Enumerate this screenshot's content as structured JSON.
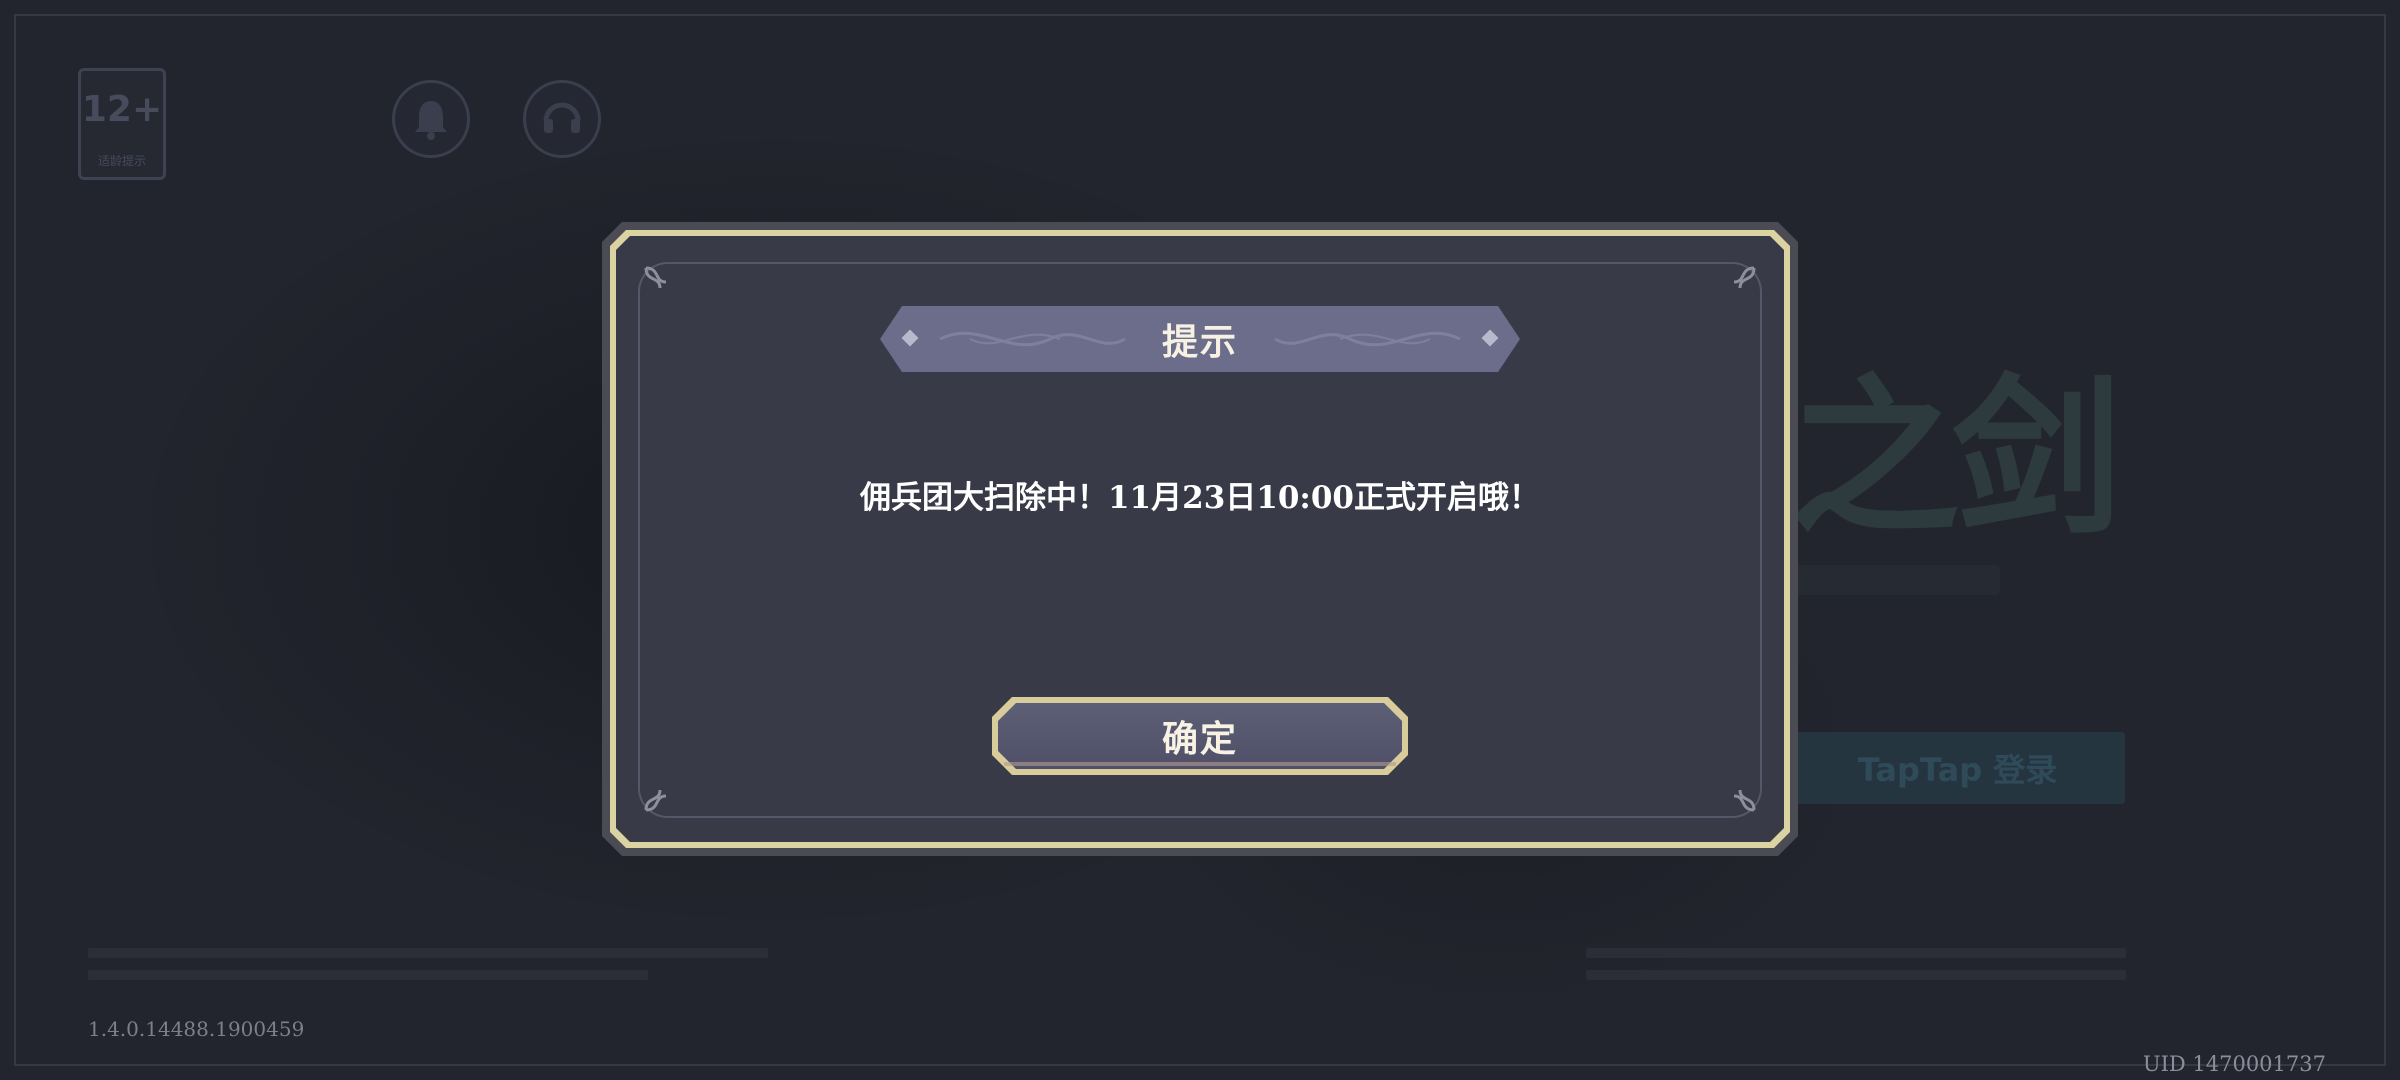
{
  "background": {
    "age_rating": "12+",
    "age_rating_caption": "适龄提示",
    "login_button_label": "TapTap 登录",
    "logo_text": "之剑",
    "version": "1.4.0.14488.1900459",
    "uid": "UID 1470001737"
  },
  "dialog": {
    "title": "提示",
    "message": "佣兵团大扫除中！11月23日10:00正式开启哦！",
    "confirm_label": "确定"
  },
  "colors": {
    "dialog_bg": "#393a47",
    "dialog_border": "#dcd3a3",
    "title_banner": "#6b6d8b",
    "button_bg": "#5d5f77"
  }
}
